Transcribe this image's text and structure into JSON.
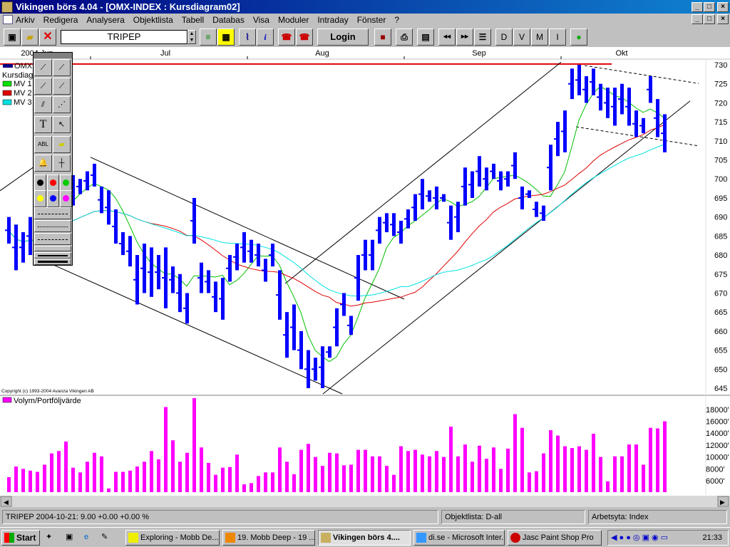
{
  "window": {
    "title": "Vikingen börs 4.04 - [OMX-INDEX : Kursdiagram02]",
    "min": "_",
    "max": "□",
    "close": "×"
  },
  "menu": [
    "Arkiv",
    "Redigera",
    "Analysera",
    "Objektlista",
    "Tabell",
    "Databas",
    "Visa",
    "Moduler",
    "Intraday",
    "Fönster",
    "?"
  ],
  "toolbar": {
    "symbol": "TRIPEP",
    "login": "Login",
    "period_buttons": [
      "D",
      "V",
      "M",
      "I"
    ]
  },
  "legend": {
    "series": "OMX",
    "chart": "Kursdiag",
    "mv1": "MV 1",
    "mv2": "MV 2",
    "mv3": "MV 3",
    "volume": "Volym/Portföljvärde",
    "copyright": "Copyright (c) 1993-2004 Avanza Vikingen AB"
  },
  "colors": {
    "bars": "#0000ff",
    "mv1": "#00c000",
    "mv2": "#e00000",
    "mv3": "#00e0e0",
    "volume": "#ff00ff",
    "hline": "#e00000"
  },
  "chart_data": {
    "type": "bar",
    "title": "OMX-INDEX : Kursdiagram02",
    "x_labels": [
      "2004 Jun",
      "Jul",
      "Aug",
      "Sep",
      "Okt"
    ],
    "x_label_index": [
      4,
      22,
      44,
      66,
      86
    ],
    "price_ylim": [
      645,
      730
    ],
    "price_ticks": [
      645,
      650,
      655,
      660,
      665,
      670,
      675,
      680,
      685,
      690,
      695,
      700,
      705,
      710,
      715,
      720,
      725,
      730
    ],
    "price_bars_high_low": [
      [
        690,
        683
      ],
      [
        688,
        676
      ],
      [
        686,
        678
      ],
      [
        690,
        680
      ],
      [
        688,
        680
      ],
      [
        693,
        684
      ],
      [
        697,
        686
      ],
      [
        700,
        690
      ],
      [
        702,
        695
      ],
      [
        701,
        693
      ],
      [
        700,
        696
      ],
      [
        702,
        697
      ],
      [
        704,
        698
      ],
      [
        698,
        691
      ],
      [
        697,
        688
      ],
      [
        692,
        683
      ],
      [
        686,
        680
      ],
      [
        685,
        677
      ],
      [
        680,
        667
      ],
      [
        683,
        670
      ],
      [
        682,
        669
      ],
      [
        680,
        671
      ],
      [
        682,
        666
      ],
      [
        677,
        670
      ],
      [
        675,
        665
      ],
      [
        670,
        662
      ],
      [
        695,
        683
      ],
      [
        678,
        670
      ],
      [
        676,
        670
      ],
      [
        673,
        665
      ],
      [
        674,
        663
      ],
      [
        680,
        673
      ],
      [
        683,
        676
      ],
      [
        686,
        678
      ],
      [
        684,
        678
      ],
      [
        683,
        677
      ],
      [
        679,
        673
      ],
      [
        683,
        677
      ],
      [
        676,
        663
      ],
      [
        665,
        653
      ],
      [
        667,
        655
      ],
      [
        660,
        650
      ],
      [
        655,
        645
      ],
      [
        653,
        647
      ],
      [
        656,
        645
      ],
      [
        656,
        653
      ],
      [
        666,
        656
      ],
      [
        670,
        664
      ],
      [
        664,
        659
      ],
      [
        680,
        668
      ],
      [
        684,
        676
      ],
      [
        684,
        676
      ],
      [
        690,
        683
      ],
      [
        691,
        686
      ],
      [
        691,
        685
      ],
      [
        689,
        683
      ],
      [
        692,
        687
      ],
      [
        696,
        689
      ],
      [
        700,
        692
      ],
      [
        697,
        694
      ],
      [
        698,
        692
      ],
      [
        696,
        694
      ],
      [
        693,
        684
      ],
      [
        694,
        686
      ],
      [
        703,
        693
      ],
      [
        702,
        695
      ],
      [
        706,
        698
      ],
      [
        703,
        697
      ],
      [
        704,
        700
      ],
      [
        702,
        697
      ],
      [
        702,
        698
      ],
      [
        707,
        700
      ],
      [
        698,
        692
      ],
      [
        697,
        695
      ],
      [
        694,
        690
      ],
      [
        693,
        689
      ],
      [
        709,
        697
      ],
      [
        715,
        706
      ],
      [
        718,
        707
      ],
      [
        729,
        721
      ],
      [
        730,
        722
      ],
      [
        727,
        720
      ],
      [
        729,
        722
      ],
      [
        725,
        718
      ],
      [
        724,
        716
      ],
      [
        724,
        714
      ],
      [
        725,
        717
      ],
      [
        724,
        714
      ],
      [
        718,
        711
      ],
      [
        716,
        712
      ],
      [
        727,
        720
      ],
      [
        721,
        711
      ],
      [
        717,
        707
      ]
    ],
    "volume_ylim": [
      4000,
      19000
    ],
    "volume_ticks": [
      "6000'",
      "8000'",
      "10000'",
      "12000'",
      "14000'",
      "16000'",
      "18000'"
    ],
    "volume_values": [
      6600,
      8400,
      8000,
      7700,
      7500,
      8700,
      10600,
      11000,
      12600,
      8200,
      7400,
      9200,
      10700,
      10100,
      4700,
      7500,
      7500,
      7700,
      8400,
      9200,
      11000,
      9600,
      18400,
      12800,
      9200,
      10700,
      19900,
      11600,
      9000,
      7000,
      8200,
      8300,
      10400,
      5400,
      5600,
      6800,
      7400,
      7400,
      11600,
      9200,
      7100,
      11200,
      12200,
      10000,
      8500,
      10700,
      10600,
      8600,
      8700,
      11200,
      11200,
      10100,
      10100,
      8500,
      7000,
      11800,
      11000,
      11200,
      10400,
      10100,
      11000,
      10000,
      15100,
      10100,
      12100,
      9200,
      11900,
      9700,
      11600,
      8000,
      11400,
      17200,
      14900,
      7400,
      7600,
      10600,
      14500,
      13600,
      11800,
      11500,
      11800,
      11200,
      13900,
      10000,
      5900,
      10100,
      10100,
      12100,
      12100,
      8700,
      14900,
      14800,
      16000
    ],
    "horizontal_line": 730.2,
    "trendlines": [
      {
        "x1": 11.5,
        "y1": 705.7,
        "x2": 55.5,
        "y2": 668.4,
        "dash": false
      },
      {
        "x1": 6.3,
        "y1": 677.4,
        "x2": 46.8,
        "y2": 643.5,
        "dash": false
      },
      {
        "x1": 38.8,
        "y1": 672.5,
        "x2": 77.5,
        "y2": 730.7,
        "dash": false
      },
      {
        "x1": 44.1,
        "y1": 643.5,
        "x2": 95.6,
        "y2": 720.5,
        "dash": false
      },
      {
        "x1": 80.8,
        "y1": 729.8,
        "x2": 96.8,
        "y2": 725.1,
        "dash": true
      },
      {
        "x1": 79.6,
        "y1": 713.7,
        "x2": 96.8,
        "y2": 708.7,
        "dash": true
      },
      {
        "x1": -1.2,
        "y1": 696.9,
        "x2": 3.8,
        "y2": 703.5,
        "dash": false
      }
    ]
  },
  "status": {
    "quote": "TRIPEP 2004-10-21:   9.00   +0.00    +0.00 %",
    "list": "Objektlista: D-all",
    "workspace": "Arbetsyta: Index"
  },
  "taskbar": {
    "start": "Start",
    "tasks": [
      "Exploring - Mobb De...",
      "19. Mobb Deep - 19 ...",
      "Vikingen börs 4....",
      "di.se - Microsoft Inter...",
      "Jasc Paint Shop Pro"
    ],
    "clock": "21:33"
  }
}
